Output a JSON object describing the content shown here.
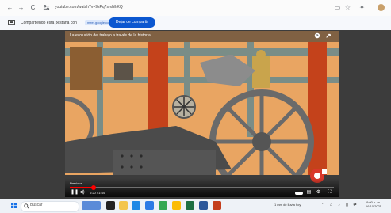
{
  "browser": {
    "url": "youtube.com/watch?v=9sPq7s-xNhKQ",
    "nav": {
      "back": "←",
      "forward": "→",
      "reload": "C"
    }
  },
  "sharebar": {
    "text": "Compartiendo esta pestaña con",
    "chip": "meet.google.com",
    "stop_label": "Dejar de compartir"
  },
  "video": {
    "title": "La evolución del trabajo a través de la historia",
    "hint": "Presiona",
    "time": "0:20 / 1:54",
    "progress": 0.09,
    "accent": "#ff0000"
  },
  "taskbar": {
    "search_placeholder": "Buscar",
    "weather": "1 mm de lluvia hoy",
    "clock_time": "9:00 p. m.",
    "clock_date": "16/10/2025"
  }
}
